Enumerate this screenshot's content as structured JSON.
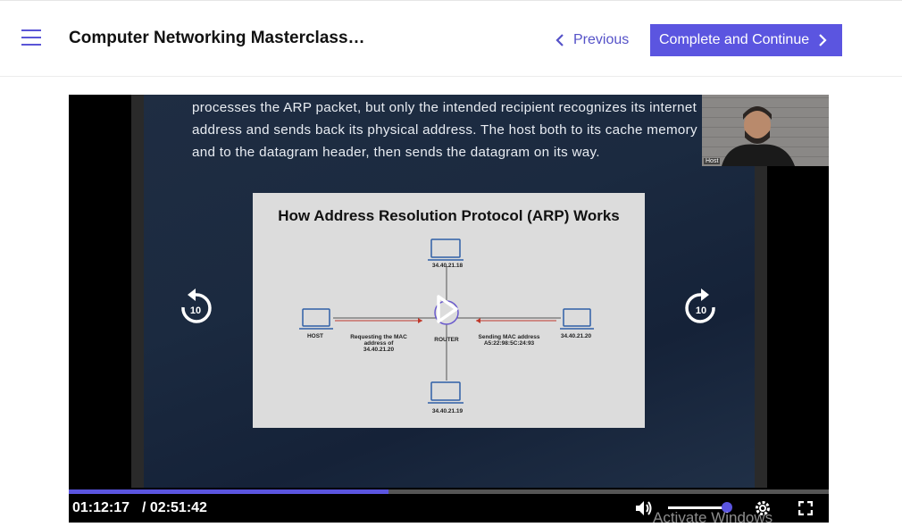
{
  "header": {
    "course_title": "Computer Networking Masterclass…",
    "previous_label": "Previous",
    "complete_label": "Complete and Continue"
  },
  "slide": {
    "paragraph": "processes the ARP packet, but only the intended recipient recognizes its internet address and sends back its physical address. The host both to its cache memory and to the datagram header, then sends the datagram on its way.",
    "diagram_title": "How Address Resolution Protocol (ARP) Works",
    "top_ip": "34.40.21.18",
    "bottom_ip": "34.40.21.19",
    "right_ip": "34.40.21.20",
    "host_label": "HOST",
    "router_label": "ROUTER",
    "request_label": "Requesting the MAC address of 34.40.21.20",
    "sending_label": "Sending MAC address A5:22:98:5C:24:93"
  },
  "webcam": {
    "tag": "Host"
  },
  "player": {
    "current_time": "01:12:17",
    "duration": "/ 02:51:42",
    "progress": 0.421,
    "volume": 0.9,
    "rewind_seconds": "10",
    "forward_seconds": "10"
  },
  "overlay": {
    "watermark": "Activate Windows"
  },
  "colors": {
    "accent": "#5b55e0",
    "link": "#5552c8"
  }
}
